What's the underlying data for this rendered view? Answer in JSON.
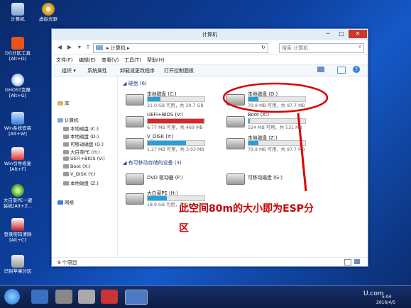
{
  "desktop_icons": [
    {
      "label1": "计算机",
      "label2": ""
    },
    {
      "label1": "虚拟光驱",
      "label2": ""
    },
    {
      "label1": "DG分区工具",
      "label2": "[Alt+D]"
    },
    {
      "label1": "GHOST克隆",
      "label2": "[Alt+G]"
    },
    {
      "label1": "Win系统安装",
      "label2": "[Alt+W]"
    },
    {
      "label1": "Win引导修复",
      "label2": "[Alt+F]"
    },
    {
      "label1": "大白菜PE一键",
      "label2": "装机[Alt+Z..."
    },
    {
      "label1": "登录密码清除",
      "label2": "[Alt+C]"
    },
    {
      "label1": "识别苹果分区",
      "label2": ""
    }
  ],
  "window": {
    "title": "计算机",
    "minimize": "─",
    "maximize": "□",
    "close": "✕",
    "address": "▸ 计算机 ▸",
    "search_placeholder": "搜索 计算机",
    "menu": [
      "文件(F)",
      "编辑(E)",
      "查看(V)",
      "工具(T)",
      "帮助(H)"
    ],
    "toolbar": [
      "组织 ▾",
      "系统属性",
      "卸载或更改程序",
      "打开控制面板"
    ]
  },
  "navpane": [
    {
      "label": "库"
    },
    {
      "label": "计算机"
    },
    {
      "label": "本地磁盘 (C:)"
    },
    {
      "label": "本地磁盘 (D:)"
    },
    {
      "label": "可移动磁盘 (G:)"
    },
    {
      "label": "大白菜PE (H:)"
    },
    {
      "label": "UEFI+BIOS (V:)"
    },
    {
      "label": "Boot (X:)"
    },
    {
      "label": "V_DISK (Y:)"
    },
    {
      "label": "本地磁盘 (Z:)"
    },
    {
      "label": "网络"
    }
  ],
  "sections": {
    "hdd": "◢ 硬盘 (6)",
    "removable": "◢ 有可移动存储的设备 (3)"
  },
  "drives": [
    {
      "name": "本地磁盘 (C:)",
      "size": "31.0 GB 可用，共 39.7 GB",
      "used": 0.22,
      "color": "#26a0da"
    },
    {
      "name": "本地磁盘 (D:)",
      "size": "79.9 MB 可用，共 97.7 MB",
      "used": 0.18,
      "color": "#26a0da"
    },
    {
      "name": "UEFI+BIOS (V:)",
      "size": "6.77 MB 可用，共 469 MB",
      "used": 0.99,
      "color": "#da2626"
    },
    {
      "name": "Boot (X:)",
      "size": "524 MB 可用，共 531 MB",
      "used": 0.02,
      "color": "#26a0da"
    },
    {
      "name": "V_DISK (Y:)",
      "size": "1.27 MB 可用，共 3.93 MB",
      "used": 0.68,
      "color": "#26a0da"
    },
    {
      "name": "本地磁盘 (Z:)",
      "size": "79.9 MB 可用，共 97.7 MB",
      "used": 0.18,
      "color": "#26a0da"
    },
    {
      "name": "DVD 驱动器 (F:)",
      "size": "",
      "used": null,
      "color": ""
    },
    {
      "name": "可移动磁盘 (G:)",
      "size": "",
      "used": null,
      "color": ""
    },
    {
      "name": "大白菜PE (H:)",
      "size": "18.9 GB 可用，共 28.8 GB",
      "used": 0.34,
      "color": "#26a0da"
    }
  ],
  "status": "9 个项目",
  "annotation": {
    "line1": "此空间80m的大小即为ESP分",
    "line2": "区"
  },
  "taskbar": {
    "time": "5:04",
    "date": "2016/4/5",
    "watermark": "U.com"
  }
}
